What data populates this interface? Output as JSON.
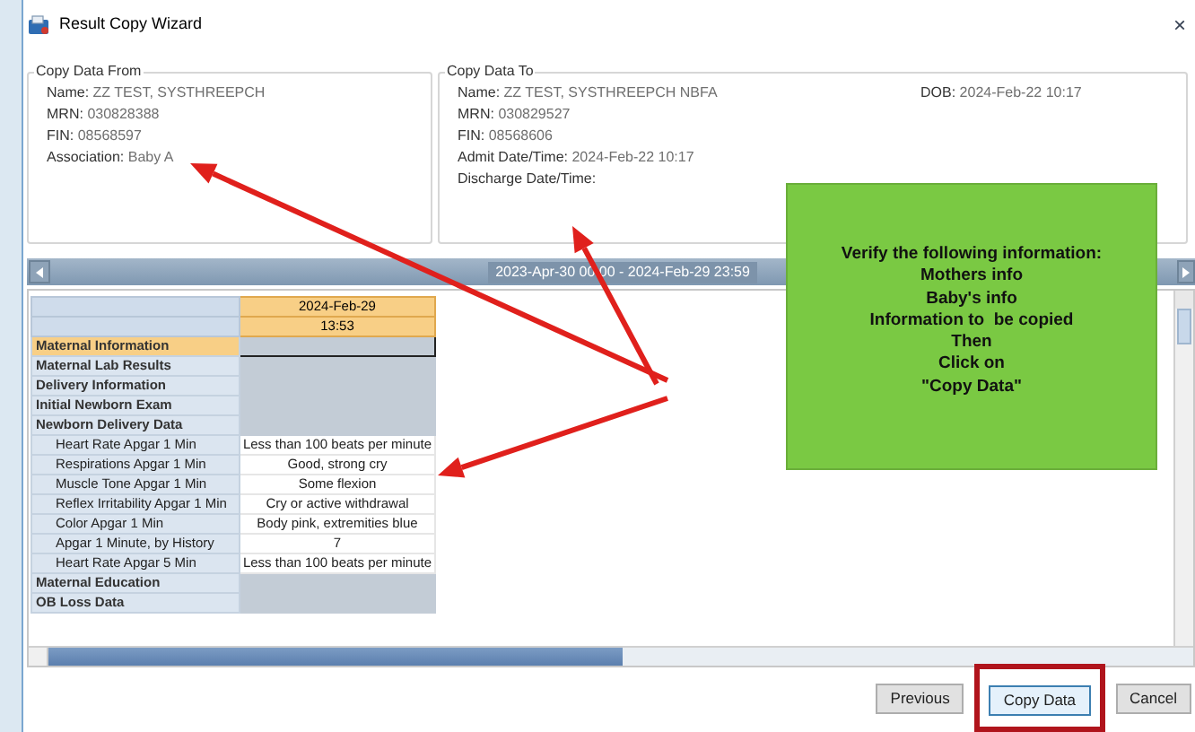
{
  "window": {
    "title": "Result Copy Wizard",
    "close": "×"
  },
  "copy_from": {
    "title": "Copy Data From",
    "fields": [
      {
        "label": "Name:",
        "value": "ZZ TEST, SYSTHREEPCH"
      },
      {
        "label": "MRN:",
        "value": "030828388"
      },
      {
        "label": "FIN:",
        "value": "08568597"
      },
      {
        "label": "Association:",
        "value": "Baby A"
      }
    ]
  },
  "copy_to": {
    "title": "Copy Data To",
    "fields": [
      {
        "label": "Name:",
        "value": "ZZ TEST, SYSTHREEPCH NBFA"
      },
      {
        "label": "MRN:",
        "value": "030829527"
      },
      {
        "label": "FIN:",
        "value": "08568606"
      },
      {
        "label": "Admit Date/Time:",
        "value": "2024-Feb-22 10:17"
      },
      {
        "label": "Discharge Date/Time:"
      }
    ],
    "dob": {
      "label": "DOB:",
      "value": "2024-Feb-22 10:17"
    }
  },
  "timeline": {
    "range": "2023-Apr-30 00:00 - 2024-Feb-29 23:59"
  },
  "grid": {
    "date": "2024-Feb-29",
    "time": "13:53",
    "rows": [
      {
        "label": "Maternal Information",
        "selected": true
      },
      {
        "label": "Maternal Lab Results",
        "selected": false
      },
      {
        "label": "Delivery Information",
        "selected": false
      },
      {
        "label": "Initial Newborn Exam",
        "selected": false
      },
      {
        "label": "Newborn Delivery Data",
        "selected": false,
        "children": [
          {
            "label": "Heart Rate Apgar 1 Min",
            "value": "Less than 100 beats per minute",
            "selected": false
          },
          {
            "label": "Respirations Apgar 1 Min",
            "value": "Good, strong cry",
            "selected": false
          },
          {
            "label": "Muscle Tone Apgar 1 Min",
            "value": "Some flexion",
            "selected": false
          },
          {
            "label": "Reflex Irritability Apgar 1 Min",
            "value": "Cry or active withdrawal",
            "selected": false
          },
          {
            "label": "Color Apgar 1 Min",
            "value": "Body pink, extremities blue",
            "selected": false
          },
          {
            "label": "Apgar 1 Minute, by History",
            "value": "7",
            "selected": false
          },
          {
            "label": "Heart Rate Apgar 5 Min",
            "value": "Less than 100 beats per minute",
            "selected": false
          }
        ]
      },
      {
        "label": "Maternal Education",
        "selected": false
      },
      {
        "label": "OB Loss Data",
        "selected": false
      }
    ]
  },
  "callout": {
    "lines": [
      "Verify the following information:",
      "Mothers info",
      "Baby's info",
      "Information to  be copied",
      "Then",
      "Click on",
      "\"Copy Data\""
    ]
  },
  "buttons": [
    {
      "label": "Previous",
      "highlighted": false
    },
    {
      "label": "Copy Data",
      "highlighted": true
    },
    {
      "label": "Cancel",
      "highlighted": false
    }
  ]
}
